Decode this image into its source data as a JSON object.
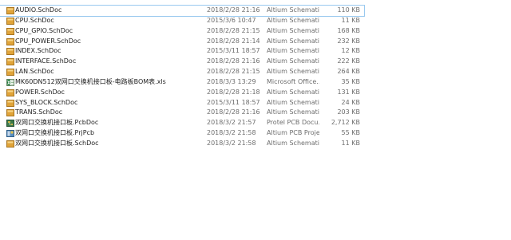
{
  "files": [
    {
      "name": "AUDIO.SchDoc",
      "date": "2018/2/28 21:16",
      "type": "Altium Schemati...",
      "size": "110 KB",
      "icon": "schdoc-icon",
      "selected": true
    },
    {
      "name": "CPU.SchDoc",
      "date": "2015/3/6 10:47",
      "type": "Altium Schemati...",
      "size": "11 KB",
      "icon": "schdoc-icon"
    },
    {
      "name": "CPU_GPIO.SchDoc",
      "date": "2018/2/28 21:15",
      "type": "Altium Schemati...",
      "size": "168 KB",
      "icon": "schdoc-icon"
    },
    {
      "name": "CPU_POWER.SchDoc",
      "date": "2018/2/28 21:14",
      "type": "Altium Schemati...",
      "size": "232 KB",
      "icon": "schdoc-icon"
    },
    {
      "name": "INDEX.SchDoc",
      "date": "2015/3/11 18:57",
      "type": "Altium Schemati...",
      "size": "12 KB",
      "icon": "schdoc-icon"
    },
    {
      "name": "INTERFACE.SchDoc",
      "date": "2018/2/28 21:16",
      "type": "Altium Schemati...",
      "size": "222 KB",
      "icon": "schdoc-icon"
    },
    {
      "name": "LAN.SchDoc",
      "date": "2018/2/28 21:15",
      "type": "Altium Schemati...",
      "size": "264 KB",
      "icon": "schdoc-icon"
    },
    {
      "name": "MK60DN512双网口交换机接口板-电路板BOM表.xls",
      "date": "2018/3/3 13:29",
      "type": "Microsoft Office...",
      "size": "35 KB",
      "icon": "excel-icon"
    },
    {
      "name": "POWER.SchDoc",
      "date": "2018/2/28 21:18",
      "type": "Altium Schemati...",
      "size": "131 KB",
      "icon": "schdoc-icon"
    },
    {
      "name": "SYS_BLOCK.SchDoc",
      "date": "2015/3/11 18:57",
      "type": "Altium Schemati...",
      "size": "24 KB",
      "icon": "schdoc-icon"
    },
    {
      "name": "TRANS.SchDoc",
      "date": "2018/2/28 21:16",
      "type": "Altium Schemati...",
      "size": "203 KB",
      "icon": "schdoc-icon"
    },
    {
      "name": "双网口交换机接口板.PcbDoc",
      "date": "2018/3/2 21:57",
      "type": "Protel PCB Docu...",
      "size": "2,712 KB",
      "icon": "pcbdoc-icon"
    },
    {
      "name": "双网口交换机接口板.PrjPcb",
      "date": "2018/3/2 21:58",
      "type": "Altium PCB Proje...",
      "size": "55 KB",
      "icon": "prjpcb-icon"
    },
    {
      "name": "双网口交换机接口板.SchDoc",
      "date": "2018/3/2 21:58",
      "type": "Altium Schemati...",
      "size": "11 KB",
      "icon": "schdoc-icon"
    }
  ]
}
